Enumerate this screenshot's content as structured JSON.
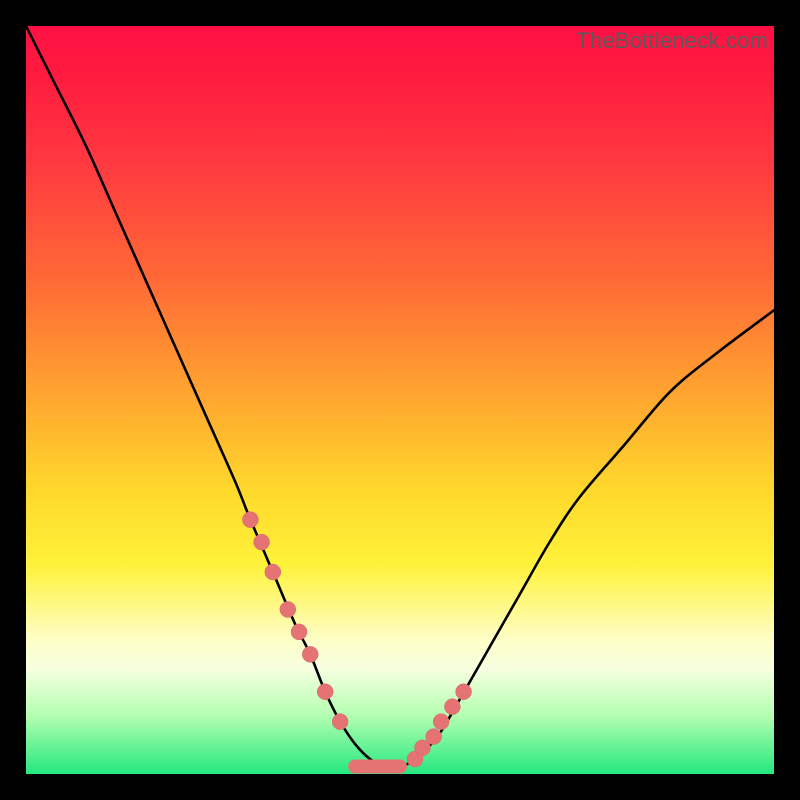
{
  "watermark": "TheBottleneck.com",
  "colors": {
    "gradient_top": "#ff1044",
    "gradient_mid1": "#ff6a36",
    "gradient_mid2": "#ffd82c",
    "gradient_pale": "#fefec6",
    "gradient_bottom": "#24e87e",
    "curve": "#000000",
    "marker": "#e57373",
    "frame": "#000000"
  },
  "chart_data": {
    "type": "line",
    "title": "",
    "xlabel": "",
    "ylabel": "",
    "xlim": [
      0,
      100
    ],
    "ylim": [
      0,
      100
    ],
    "series": [
      {
        "name": "bottleneck-curve",
        "x": [
          0,
          4,
          8,
          12,
          16,
          20,
          24,
          28,
          30,
          33,
          36,
          38,
          40,
          42,
          44,
          46,
          48,
          50,
          52,
          55,
          58,
          62,
          66,
          70,
          74,
          80,
          86,
          92,
          100
        ],
        "y": [
          100,
          92,
          84,
          75,
          66,
          57,
          48,
          39,
          34,
          27,
          20,
          16,
          11,
          7,
          4,
          2,
          1,
          1,
          2,
          5,
          10,
          17,
          24,
          31,
          37,
          44,
          51,
          56,
          62
        ]
      }
    ],
    "markers": {
      "name": "highlight-dots",
      "x": [
        30,
        31.5,
        33,
        35,
        36.5,
        38,
        40,
        42,
        52,
        53,
        54.5,
        55.5,
        57,
        58.5
      ],
      "y": [
        34,
        31,
        27,
        22,
        19,
        16,
        11,
        7,
        2,
        3.5,
        5,
        7,
        9,
        11
      ]
    },
    "flat_bottom": {
      "x0": 44,
      "x1": 50,
      "y": 1
    }
  }
}
